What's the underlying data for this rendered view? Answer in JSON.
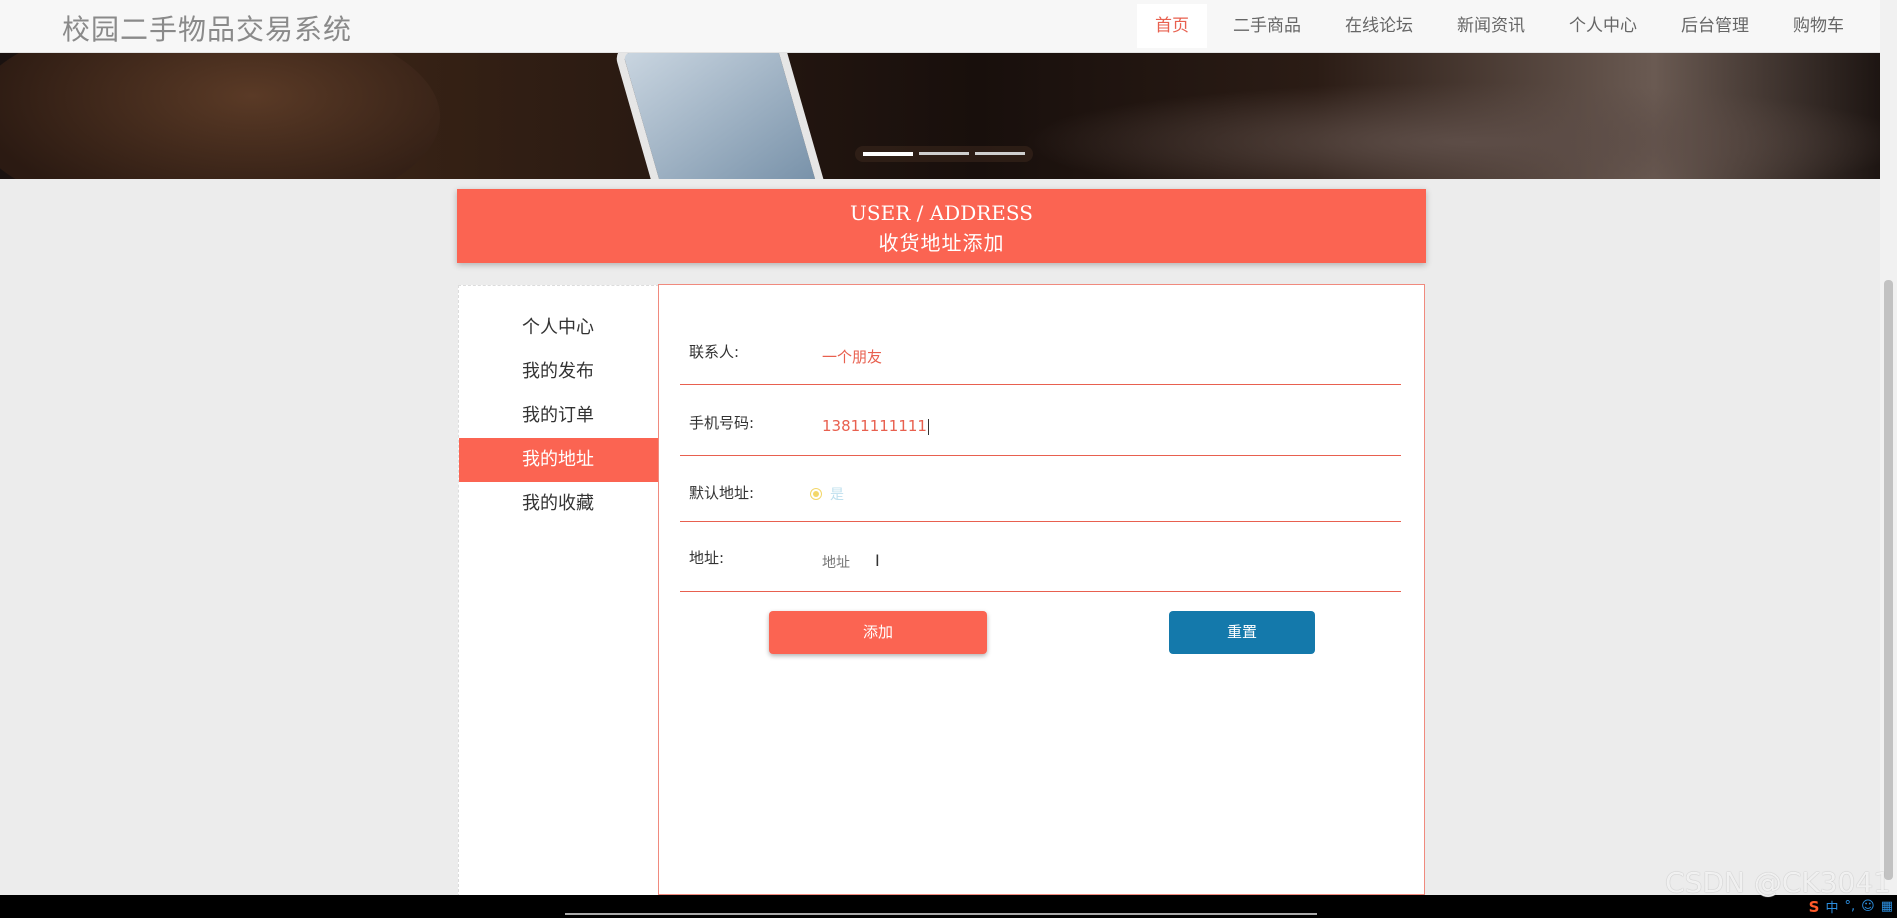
{
  "header": {
    "site_title": "校园二手物品交易系统",
    "nav": [
      "首页",
      "二手商品",
      "在线论坛",
      "新闻资讯",
      "个人中心",
      "后台管理",
      "购物车"
    ],
    "active_nav": "首页"
  },
  "title_block": {
    "en": "USER / ADDRESS",
    "cn": "收货地址添加"
  },
  "sidebar": {
    "items": [
      "个人中心",
      "我的发布",
      "我的订单",
      "我的地址",
      "我的收藏"
    ],
    "active": "我的地址"
  },
  "form": {
    "contact": {
      "label": "联系人:",
      "value": "一个朋友"
    },
    "phone": {
      "label": "手机号码:",
      "value": "13811111111"
    },
    "default_address": {
      "label": "默认地址:",
      "option": "是"
    },
    "address": {
      "label": "地址:",
      "placeholder": "地址"
    },
    "add_label": "添加",
    "reset_label": "重置"
  },
  "taskbar": {
    "ime": "中",
    "watermark": "CSDN @CK3041"
  },
  "colors": {
    "accent": "#fb6452",
    "reset": "#1479ab",
    "nav_active": "#e8604f"
  }
}
